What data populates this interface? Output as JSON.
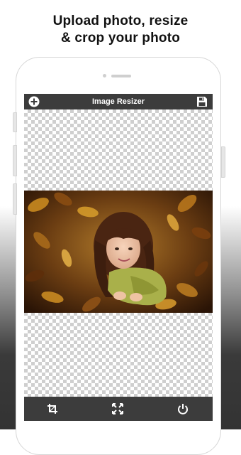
{
  "promo": {
    "line1": "Upload photo, resize",
    "line2": "& crop your photo"
  },
  "app": {
    "title": "Image Resizer",
    "top_left_icon": "add-circle-icon",
    "top_right_icon": "save-icon",
    "bottom_icons": [
      "crop-icon",
      "fullscreen-icon",
      "power-icon"
    ]
  },
  "photo": {
    "description_icon": "photo-girl-autumn-leaves"
  },
  "colors": {
    "toolbar": "#3c3c3c",
    "checker": "#cfcfcf",
    "icon": "#ffffff"
  }
}
